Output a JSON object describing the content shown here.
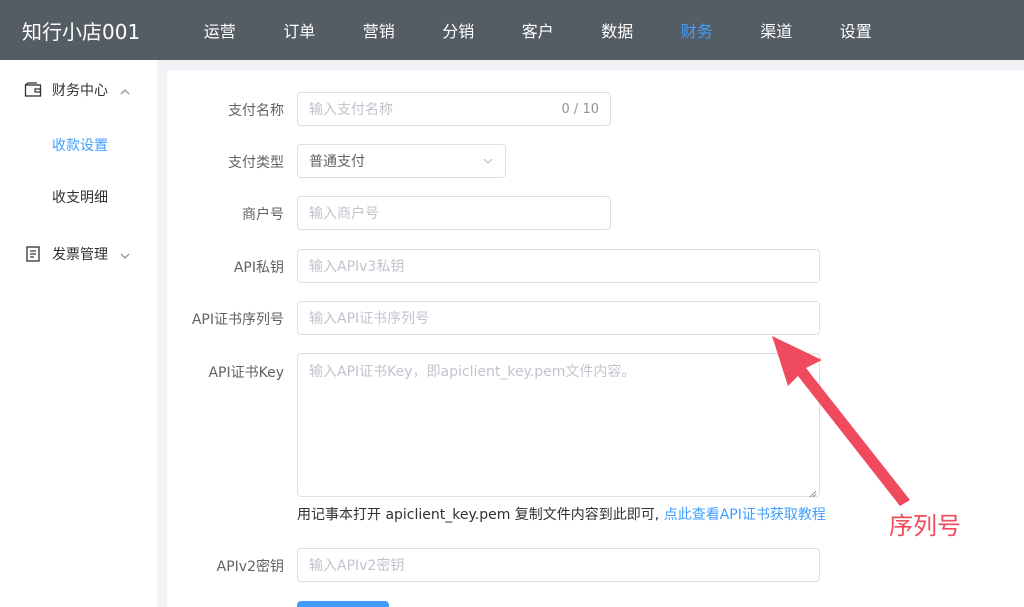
{
  "app": {
    "title": "知行小店001"
  },
  "nav": {
    "items": [
      "运营",
      "订单",
      "营销",
      "分销",
      "客户",
      "数据",
      "财务",
      "渠道",
      "设置"
    ],
    "active_index": 6
  },
  "sidebar": {
    "finance_center": "财务中心",
    "payment_settings": "收款设置",
    "income_details": "收支明细",
    "invoice_management": "发票管理"
  },
  "form": {
    "pay_name": {
      "label": "支付名称",
      "placeholder": "输入支付名称",
      "counter": "0 / 10"
    },
    "pay_type": {
      "label": "支付类型",
      "value": "普通支付"
    },
    "merchant_no": {
      "label": "商户号",
      "placeholder": "输入商户号"
    },
    "api_private_key": {
      "label": "API私钥",
      "placeholder": "输入APIv3私钥"
    },
    "api_cert_serial": {
      "label": "API证书序列号",
      "placeholder": "输入API证书序列号"
    },
    "api_cert_key": {
      "label": "API证书Key",
      "placeholder": "输入API证书Key，即apiclient_key.pem文件内容。"
    },
    "hint_text": "用记事本打开 apiclient_key.pem 复制文件内容到此即可,",
    "hint_link": "点此查看API证书获取教程",
    "apiv2_key": {
      "label": "APIv2密钥",
      "placeholder": "输入APIv2密钥"
    }
  },
  "annotation": {
    "text": "序列号",
    "color": "#f04a5e"
  },
  "colors": {
    "nav_bg": "#545c64",
    "accent": "#409eff"
  }
}
